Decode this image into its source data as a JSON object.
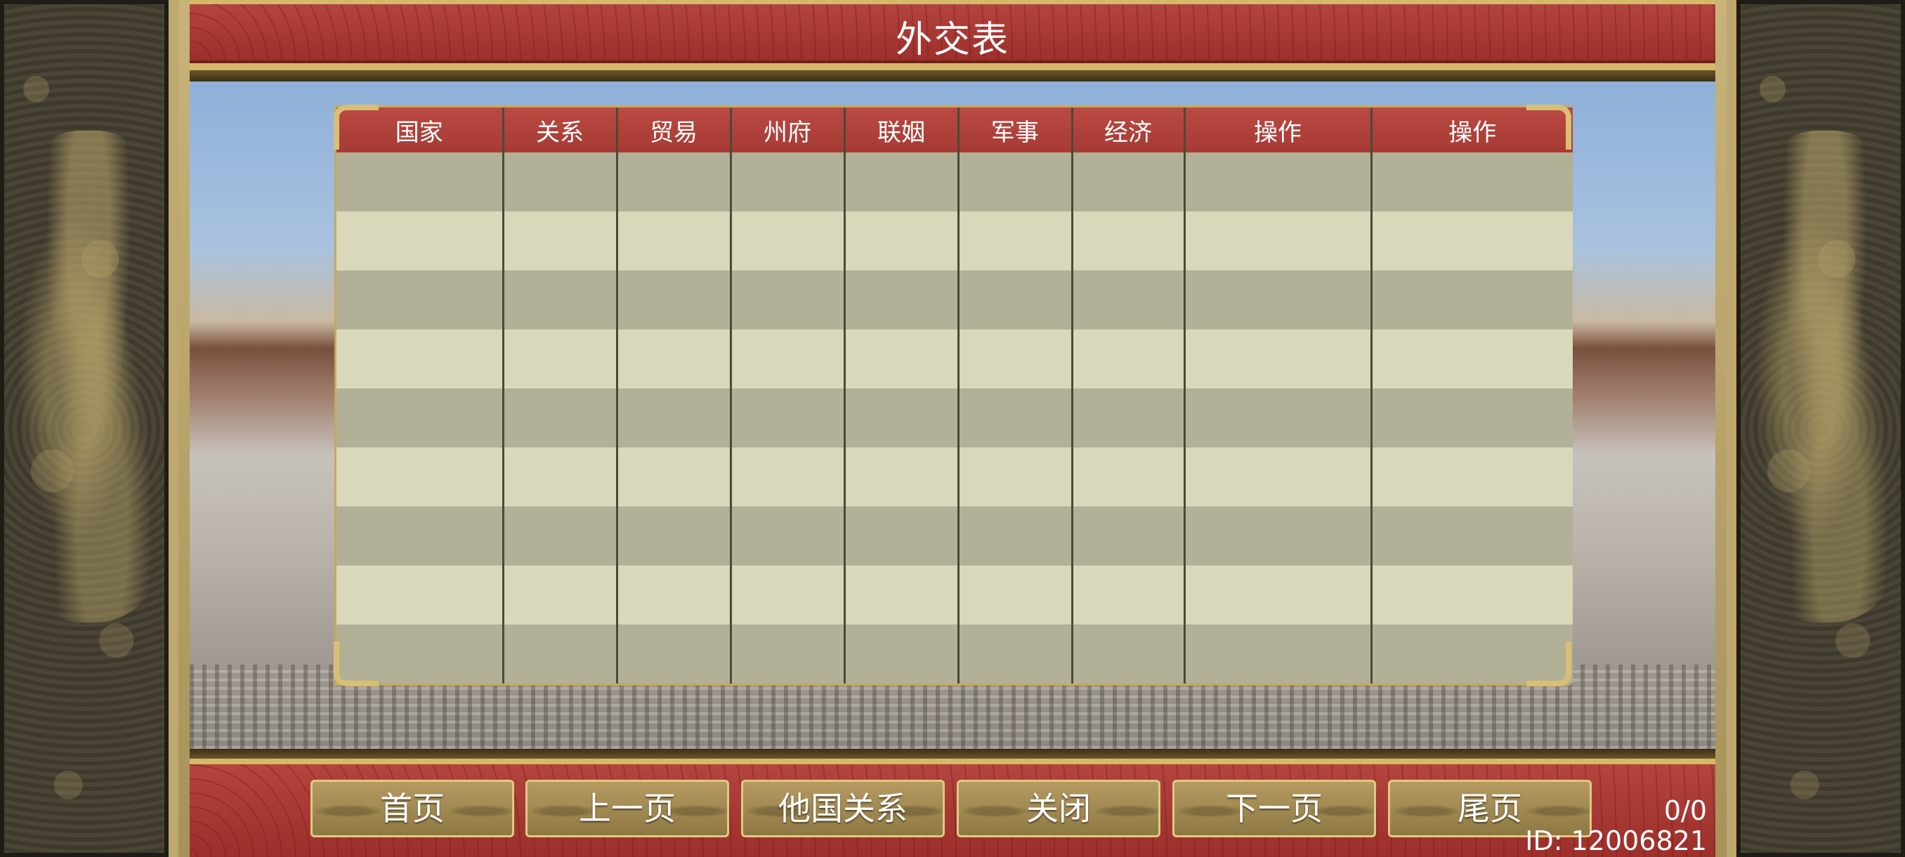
{
  "window": {
    "title": "外交表"
  },
  "table": {
    "columns": [
      "国家",
      "关系",
      "贸易",
      "州府",
      "联姻",
      "军事",
      "经济",
      "操作",
      "操作"
    ],
    "rows": [
      [
        "",
        "",
        "",
        "",
        "",
        "",
        "",
        "",
        ""
      ],
      [
        "",
        "",
        "",
        "",
        "",
        "",
        "",
        "",
        ""
      ],
      [
        "",
        "",
        "",
        "",
        "",
        "",
        "",
        "",
        ""
      ],
      [
        "",
        "",
        "",
        "",
        "",
        "",
        "",
        "",
        ""
      ],
      [
        "",
        "",
        "",
        "",
        "",
        "",
        "",
        "",
        ""
      ],
      [
        "",
        "",
        "",
        "",
        "",
        "",
        "",
        "",
        ""
      ],
      [
        "",
        "",
        "",
        "",
        "",
        "",
        "",
        "",
        ""
      ],
      [
        "",
        "",
        "",
        "",
        "",
        "",
        "",
        "",
        ""
      ],
      [
        "",
        "",
        "",
        "",
        "",
        "",
        "",
        "",
        ""
      ]
    ]
  },
  "footer": {
    "buttons": {
      "first": "首页",
      "prev": "上一页",
      "others": "他国关系",
      "close": "关闭",
      "next": "下一页",
      "last": "尾页"
    },
    "page_count": "0/0",
    "user_id": "ID: 12006821"
  },
  "colors": {
    "header_red": "#b3443e",
    "gold_border": "#d6b86b",
    "row_dark": "#b2b096",
    "row_light": "#d9d8bb"
  }
}
